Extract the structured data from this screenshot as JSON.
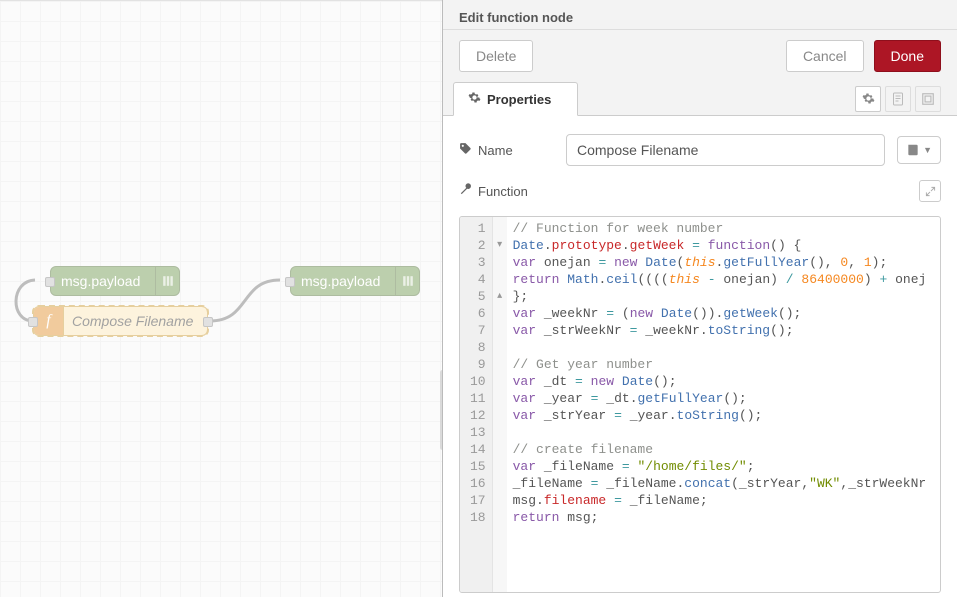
{
  "canvas": {
    "nodes": {
      "debug1": {
        "label": "msg.payload"
      },
      "debug2": {
        "label": "msg.payload"
      },
      "func": {
        "label": "Compose Filename",
        "icon": "f"
      }
    }
  },
  "panel": {
    "title": "Edit function node",
    "buttons": {
      "delete": "Delete",
      "cancel": "Cancel",
      "done": "Done"
    },
    "tab_label": "Properties",
    "form": {
      "name_label": "Name",
      "name_value": "Compose Filename",
      "function_label": "Function"
    },
    "code": {
      "lines": [
        {
          "n": 1,
          "html": "<span class='tok-comment'>// Function for week number</span>"
        },
        {
          "n": 2,
          "html": "<span class='tok-support'>Date</span><span class='tok-punct'>.</span><span class='tok-var'>prototype</span><span class='tok-punct'>.</span><span class='tok-func'>getWeek</span> <span class='tok-assign'>=</span> <span class='tok-keyword'>function</span><span class='tok-punct'>() {</span>"
        },
        {
          "n": 3,
          "html": "<span class='tok-keyword'>var</span> <span class='tok-ident'>onejan</span> <span class='tok-assign'>=</span> <span class='tok-keyword'>new</span> <span class='tok-support'>Date</span><span class='tok-punct'>(</span><span class='tok-lang'>this</span><span class='tok-punct'>.</span><span class='tok-prop'>getFullYear</span><span class='tok-punct'>(), </span><span class='tok-number'>0</span><span class='tok-punct'>, </span><span class='tok-number'>1</span><span class='tok-punct'>);</span>"
        },
        {
          "n": 4,
          "html": "<span class='tok-keyword'>return</span> <span class='tok-support'>Math</span><span class='tok-punct'>.</span><span class='tok-prop'>ceil</span><span class='tok-punct'>((((</span><span class='tok-lang'>this</span> <span class='tok-assign'>-</span> <span class='tok-ident'>onejan</span><span class='tok-punct'>)</span> <span class='tok-assign'>/</span> <span class='tok-number'>86400000</span><span class='tok-punct'>)</span> <span class='tok-assign'>+</span> <span class='tok-ident'>onej</span>"
        },
        {
          "n": 5,
          "html": "<span class='tok-punct'>};</span>"
        },
        {
          "n": 6,
          "html": "<span class='tok-keyword'>var</span> <span class='tok-ident'>_weekNr</span> <span class='tok-assign'>=</span> <span class='tok-punct'>(</span><span class='tok-keyword'>new</span> <span class='tok-support'>Date</span><span class='tok-punct'>()).</span><span class='tok-prop'>getWeek</span><span class='tok-punct'>();</span>"
        },
        {
          "n": 7,
          "html": "<span class='tok-keyword'>var</span> <span class='tok-ident'>_strWeekNr</span> <span class='tok-assign'>=</span> <span class='tok-ident'>_weekNr</span><span class='tok-punct'>.</span><span class='tok-prop'>toString</span><span class='tok-punct'>();</span>"
        },
        {
          "n": 8,
          "html": ""
        },
        {
          "n": 9,
          "html": "<span class='tok-comment'>// Get year number</span>"
        },
        {
          "n": 10,
          "html": "<span class='tok-keyword'>var</span> <span class='tok-ident'>_dt</span> <span class='tok-assign'>=</span> <span class='tok-keyword'>new</span> <span class='tok-support'>Date</span><span class='tok-punct'>();</span>"
        },
        {
          "n": 11,
          "html": "<span class='tok-keyword'>var</span> <span class='tok-ident'>_year</span> <span class='tok-assign'>=</span> <span class='tok-ident'>_dt</span><span class='tok-punct'>.</span><span class='tok-prop'>getFullYear</span><span class='tok-punct'>();</span>"
        },
        {
          "n": 12,
          "html": "<span class='tok-keyword'>var</span> <span class='tok-ident'>_strYear</span> <span class='tok-assign'>=</span> <span class='tok-ident'>_year</span><span class='tok-punct'>.</span><span class='tok-prop'>toString</span><span class='tok-punct'>();</span>"
        },
        {
          "n": 13,
          "html": ""
        },
        {
          "n": 14,
          "html": "<span class='tok-comment'>// create filename</span>"
        },
        {
          "n": 15,
          "html": "<span class='tok-keyword'>var</span> <span class='tok-ident'>_fileName</span> <span class='tok-assign'>=</span> <span class='tok-string'>\"/home/files/\"</span><span class='tok-punct'>;</span>"
        },
        {
          "n": 16,
          "html": "<span class='tok-ident'>_fileName</span> <span class='tok-assign'>=</span> <span class='tok-ident'>_fileName</span><span class='tok-punct'>.</span><span class='tok-prop'>concat</span><span class='tok-punct'>(</span><span class='tok-ident'>_strYear</span><span class='tok-punct'>,</span><span class='tok-string'>\"WK\"</span><span class='tok-punct'>,</span><span class='tok-ident'>_strWeekNr</span>"
        },
        {
          "n": 17,
          "html": "<span class='tok-ident'>msg</span><span class='tok-punct'>.</span><span class='tok-func'>filename</span> <span class='tok-assign'>=</span> <span class='tok-ident'>_fileName</span><span class='tok-punct'>;</span>"
        },
        {
          "n": 18,
          "html": "<span class='tok-keyword'>return</span> <span class='tok-ident'>msg</span><span class='tok-punct'>;</span>"
        }
      ],
      "fold_markers": {
        "2": "▾",
        "5": "▴"
      }
    }
  }
}
